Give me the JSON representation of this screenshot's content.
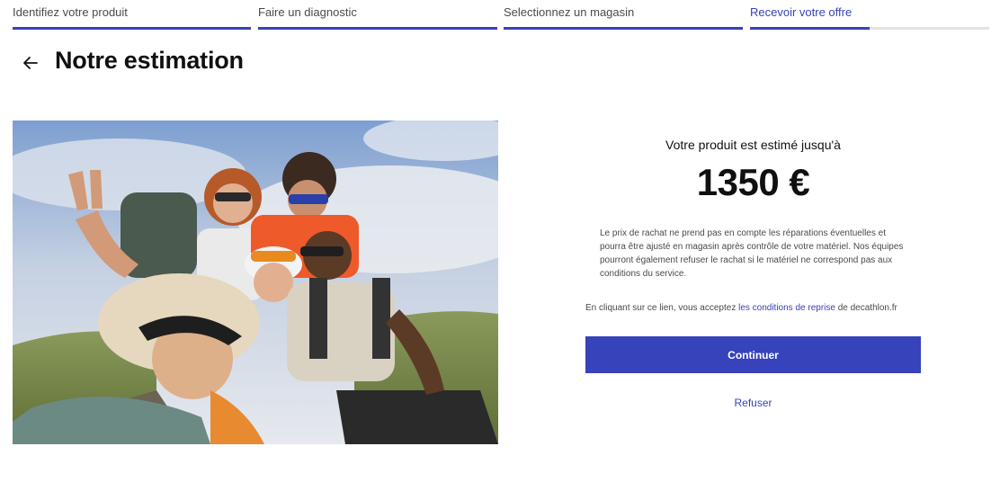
{
  "stepper": {
    "steps": [
      {
        "label": "Identifiez votre produit",
        "progress": 1.0,
        "active": false
      },
      {
        "label": "Faire un diagnostic",
        "progress": 1.0,
        "active": false
      },
      {
        "label": "Selectionnez un magasin",
        "progress": 1.0,
        "active": false
      },
      {
        "label": "Recevoir votre offre",
        "progress": 0.5,
        "active": true
      }
    ],
    "accent_color": "#3643ba",
    "track_color": "#e3e3e3"
  },
  "header": {
    "back_icon": "arrow-left-icon",
    "title": "Notre estimation"
  },
  "estimate": {
    "label": "Votre produit est estimé jusqu'à",
    "value": "1350 €",
    "disclaimer": "Le prix de rachat ne prend pas en compte les réparations éventuelles et pourra être ajusté en magasin après contrôle de votre matériel. Nos équipes pourront également refuser le rachat si le matériel ne correspond pas aux conditions du service."
  },
  "consent": {
    "prefix": "En cliquant sur ce lien, vous acceptez ",
    "link": "les conditions de reprise",
    "suffix": " de decathlon.fr"
  },
  "actions": {
    "continue_label": "Continuer",
    "refuse_label": "Refuser"
  }
}
